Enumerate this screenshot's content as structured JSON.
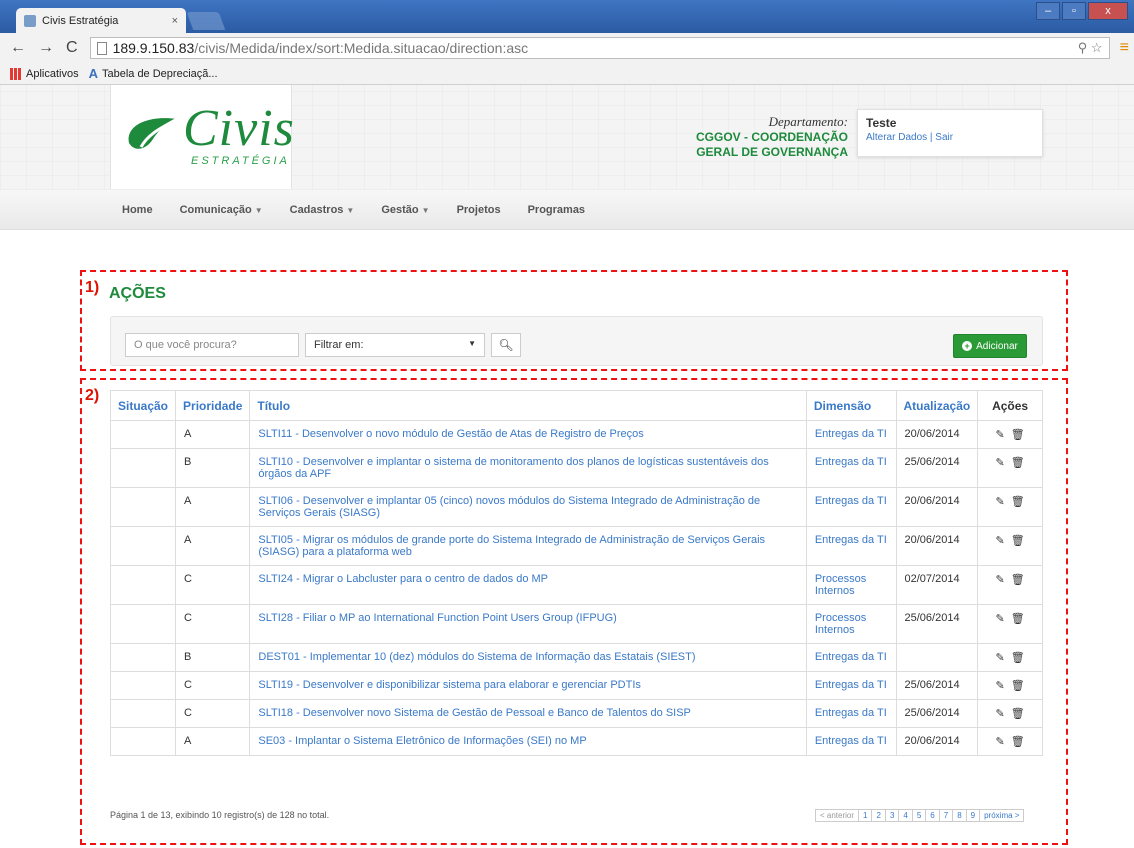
{
  "browser": {
    "tab_title": "Civis Estratégia",
    "tab_close": "×",
    "url_host": "189.9.150.83",
    "url_path": "/civis/Medida/index/sort:Medida.situacao/direction:asc",
    "bookmarks": [
      "Aplicativos",
      "Tabela de Depreciaçã..."
    ]
  },
  "header": {
    "logo_text": "Civis",
    "logo_sub": "ESTRATÉGIA",
    "dept_label": "Departamento:",
    "dept_line1": "CGGOV - COORDENAÇÃO",
    "dept_line2": "GERAL DE GOVERNANÇA",
    "user_name": "Teste",
    "user_links": "Alterar Dados | Sair"
  },
  "nav": [
    "Home",
    "Comunicação",
    "Cadastros",
    "Gestão",
    "Projetos",
    "Programas"
  ],
  "markers": {
    "m1": "1)",
    "m2": "2)"
  },
  "section": {
    "title": "AÇÕES",
    "search_placeholder": "O que você procura?",
    "filter_label": "Filtrar em:",
    "add_label": "Adicionar"
  },
  "table": {
    "headers": [
      "Situação",
      "Prioridade",
      "Título",
      "Dimensão",
      "Atualização",
      "Ações"
    ],
    "rows": [
      {
        "situacao": "",
        "prioridade": "A",
        "titulo": "SLTI11 - Desenvolver o novo módulo de Gestão de Atas de Registro de Preços",
        "dimensao": "Entregas da TI",
        "atualizacao": "20/06/2014"
      },
      {
        "situacao": "",
        "prioridade": "B",
        "titulo": "SLTI10 - Desenvolver e implantar o sistema de monitoramento dos planos de logísticas sustentáveis dos órgãos da APF",
        "dimensao": "Entregas da TI",
        "atualizacao": "25/06/2014"
      },
      {
        "situacao": "",
        "prioridade": "A",
        "titulo": "SLTI06 - Desenvolver e implantar 05 (cinco) novos módulos do Sistema Integrado de Administração de Serviços Gerais (SIASG)",
        "dimensao": "Entregas da TI",
        "atualizacao": "20/06/2014"
      },
      {
        "situacao": "",
        "prioridade": "A",
        "titulo": "SLTI05 - Migrar os módulos de grande porte do Sistema Integrado de Administração de Serviços Gerais (SIASG) para a plataforma web",
        "dimensao": "Entregas da TI",
        "atualizacao": "20/06/2014"
      },
      {
        "situacao": "",
        "prioridade": "C",
        "titulo": "SLTI24 - Migrar o Labcluster para o centro de dados do MP",
        "dimensao": "Processos Internos",
        "atualizacao": "02/07/2014"
      },
      {
        "situacao": "",
        "prioridade": "C",
        "titulo": "SLTI28 - Filiar o MP ao International Function Point Users Group (IFPUG)",
        "dimensao": "Processos Internos",
        "atualizacao": "25/06/2014"
      },
      {
        "situacao": "",
        "prioridade": "B",
        "titulo": "DEST01 - Implementar 10 (dez) módulos do Sistema de Informação das Estatais (SIEST)",
        "dimensao": "Entregas da TI",
        "atualizacao": ""
      },
      {
        "situacao": "",
        "prioridade": "C",
        "titulo": "SLTI19 - Desenvolver e disponibilizar sistema para elaborar e gerenciar PDTIs",
        "dimensao": "Entregas da TI",
        "atualizacao": "25/06/2014"
      },
      {
        "situacao": "",
        "prioridade": "C",
        "titulo": "SLTI18 - Desenvolver novo Sistema de Gestão de Pessoal e Banco de Talentos do SISP",
        "dimensao": "Entregas da TI",
        "atualizacao": "25/06/2014"
      },
      {
        "situacao": "",
        "prioridade": "A",
        "titulo": "SE03 - Implantar o Sistema Eletrônico de Informações (SEI) no MP",
        "dimensao": "Entregas da TI",
        "atualizacao": "20/06/2014"
      }
    ]
  },
  "footer": {
    "page_info": "Página 1 de 13, exibindo 10 registro(s) de 128 no total.",
    "prev": "< anterior",
    "pages": [
      "1",
      "2",
      "3",
      "4",
      "5",
      "6",
      "7",
      "8",
      "9"
    ],
    "next": "próxima >"
  }
}
